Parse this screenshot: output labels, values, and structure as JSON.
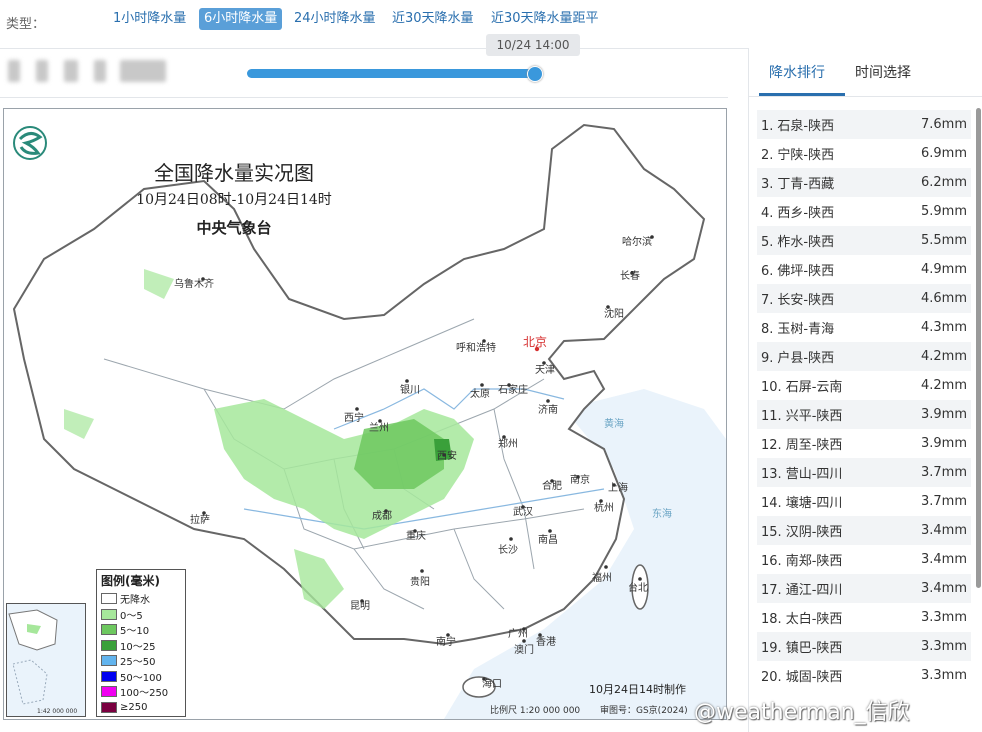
{
  "type_bar": {
    "label": "类型：",
    "tabs": [
      {
        "label": "1小时降水量",
        "active": false
      },
      {
        "label": "6小时降水量",
        "active": true
      },
      {
        "label": "24小时降水量",
        "active": false
      },
      {
        "label": "近30天降水量",
        "active": false
      },
      {
        "label": "近30天降水量距平",
        "active": false
      }
    ]
  },
  "time_slider": {
    "current": "10/24 14:00",
    "progress": 1.0
  },
  "map": {
    "title": "全国降水量实况图",
    "subtitle": "10月24日08时-10月24日14时",
    "organization": "中央气象台",
    "cities": [
      {
        "name": "乌鲁木齐",
        "capital": false
      },
      {
        "name": "哈尔滨",
        "capital": false
      },
      {
        "name": "长春",
        "capital": false
      },
      {
        "name": "沈阳",
        "capital": false
      },
      {
        "name": "呼和浩特",
        "capital": false
      },
      {
        "name": "北京",
        "capital": true
      },
      {
        "name": "天津",
        "capital": false
      },
      {
        "name": "银川",
        "capital": false
      },
      {
        "name": "太原",
        "capital": false
      },
      {
        "name": "石家庄",
        "capital": false
      },
      {
        "name": "济南",
        "capital": false
      },
      {
        "name": "西宁",
        "capital": false
      },
      {
        "name": "兰州",
        "capital": false
      },
      {
        "name": "郑州",
        "capital": false
      },
      {
        "name": "西安",
        "capital": false
      },
      {
        "name": "合肥",
        "capital": false
      },
      {
        "name": "南京",
        "capital": false
      },
      {
        "name": "上海",
        "capital": false
      },
      {
        "name": "拉萨",
        "capital": false
      },
      {
        "name": "成都",
        "capital": false
      },
      {
        "name": "武汉",
        "capital": false
      },
      {
        "name": "杭州",
        "capital": false
      },
      {
        "name": "重庆",
        "capital": false
      },
      {
        "name": "南昌",
        "capital": false
      },
      {
        "name": "长沙",
        "capital": false
      },
      {
        "name": "贵阳",
        "capital": false
      },
      {
        "name": "福州",
        "capital": false
      },
      {
        "name": "台北",
        "capital": false
      },
      {
        "name": "昆明",
        "capital": false
      },
      {
        "name": "南宁",
        "capital": false
      },
      {
        "name": "广州",
        "capital": false
      },
      {
        "name": "香港",
        "capital": false
      },
      {
        "name": "澳门",
        "capital": false
      },
      {
        "name": "海口",
        "capital": false
      },
      {
        "name": "黄海",
        "capital": false
      },
      {
        "name": "东海",
        "capital": false
      }
    ],
    "legend": {
      "title": "图例(毫米)",
      "items": [
        {
          "label": "无降水",
          "color": "#ffffff"
        },
        {
          "label": "0～5",
          "color": "#a6e79b"
        },
        {
          "label": "5～10",
          "color": "#6dc85f"
        },
        {
          "label": "10～25",
          "color": "#3aa03a"
        },
        {
          "label": "25～50",
          "color": "#62b4ee"
        },
        {
          "label": "50～100",
          "color": "#0000f0"
        },
        {
          "label": "100～250",
          "color": "#f000f0"
        },
        {
          "label": "≥250",
          "color": "#7a0040"
        }
      ]
    },
    "made_note": "10月24日14时制作",
    "scale_note": "比例尺 1:20 000 000",
    "audit_note": "审图号：GS京(2024)",
    "inset_scale": "1:42 000 000"
  },
  "panel": {
    "tabs": [
      {
        "label": "降水排行",
        "active": true
      },
      {
        "label": "时间选择",
        "active": false
      }
    ],
    "ranking": [
      {
        "rank": "1.",
        "station": "石泉-陕西",
        "value": "7.6mm"
      },
      {
        "rank": "2.",
        "station": "宁陕-陕西",
        "value": "6.9mm"
      },
      {
        "rank": "3.",
        "station": "丁青-西藏",
        "value": "6.2mm"
      },
      {
        "rank": "4.",
        "station": "西乡-陕西",
        "value": "5.9mm"
      },
      {
        "rank": "5.",
        "station": "柞水-陕西",
        "value": "5.5mm"
      },
      {
        "rank": "6.",
        "station": "佛坪-陕西",
        "value": "4.9mm"
      },
      {
        "rank": "7.",
        "station": "长安-陕西",
        "value": "4.6mm"
      },
      {
        "rank": "8.",
        "station": "玉树-青海",
        "value": "4.3mm"
      },
      {
        "rank": "9.",
        "station": "户县-陕西",
        "value": "4.2mm"
      },
      {
        "rank": "10.",
        "station": "石屏-云南",
        "value": "4.2mm"
      },
      {
        "rank": "11.",
        "station": "兴平-陕西",
        "value": "3.9mm"
      },
      {
        "rank": "12.",
        "station": "周至-陕西",
        "value": "3.9mm"
      },
      {
        "rank": "13.",
        "station": "营山-四川",
        "value": "3.7mm"
      },
      {
        "rank": "14.",
        "station": "壤塘-四川",
        "value": "3.7mm"
      },
      {
        "rank": "15.",
        "station": "汉阴-陕西",
        "value": "3.4mm"
      },
      {
        "rank": "16.",
        "station": "南郑-陕西",
        "value": "3.4mm"
      },
      {
        "rank": "17.",
        "station": "通江-四川",
        "value": "3.4mm"
      },
      {
        "rank": "18.",
        "station": "太白-陕西",
        "value": "3.3mm"
      },
      {
        "rank": "19.",
        "station": "镇巴-陕西",
        "value": "3.3mm"
      },
      {
        "rank": "20.",
        "station": "城固-陕西",
        "value": "3.3mm"
      }
    ]
  },
  "watermark": "@weatherman_信欣"
}
